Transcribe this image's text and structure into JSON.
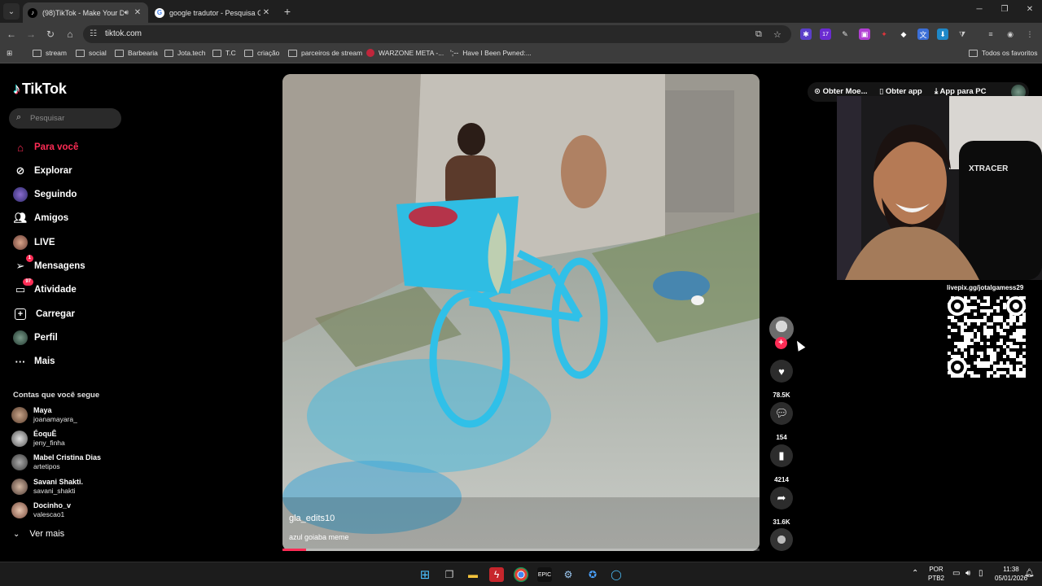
{
  "browser": {
    "tabs": [
      {
        "title": "(98)TikTok - Make Your Day",
        "active": true
      },
      {
        "title": "google tradutor - Pesquisa Goo",
        "active": false
      }
    ],
    "url": "tiktok.com",
    "bookmarks": [
      {
        "label": "stream",
        "type": "folder"
      },
      {
        "label": "social",
        "type": "folder"
      },
      {
        "label": "Barbearia",
        "type": "folder"
      },
      {
        "label": "Jota.tech",
        "type": "folder"
      },
      {
        "label": "T.C",
        "type": "folder"
      },
      {
        "label": "criação",
        "type": "folder"
      },
      {
        "label": "parceiros de stream",
        "type": "folder"
      },
      {
        "label": "WARZONE META -...",
        "type": "site"
      },
      {
        "label": "Have I Been Pwned:...",
        "type": "site"
      }
    ],
    "favorites_label": "Todos os favoritos",
    "extension_badge": "17"
  },
  "tiktok": {
    "logo": "TikTok",
    "search_placeholder": "Pesquisar",
    "nav": [
      {
        "label": "Para você",
        "icon": "home-icon",
        "active": true
      },
      {
        "label": "Explorar",
        "icon": "compass-icon"
      },
      {
        "label": "Seguindo",
        "icon": "following-avatar"
      },
      {
        "label": "Amigos",
        "icon": "friends-icon"
      },
      {
        "label": "LIVE",
        "icon": "live-avatar"
      },
      {
        "label": "Mensagens",
        "icon": "messages-icon",
        "badge": "1"
      },
      {
        "label": "Atividade",
        "icon": "activity-icon",
        "badge": "97"
      },
      {
        "label": "Carregar",
        "icon": "upload-icon"
      },
      {
        "label": "Perfil",
        "icon": "profile-avatar"
      },
      {
        "label": "Mais",
        "icon": "more-icon"
      }
    ],
    "following_title": "Contas que você segue",
    "accounts": [
      {
        "name": "Maya",
        "handle": "joanamayara_"
      },
      {
        "name": "ÉoquÊ",
        "handle": "jeny_finha"
      },
      {
        "name": "Mabel  Cristina  Dias",
        "handle": "artetipos"
      },
      {
        "name": "Savani Shakti.",
        "handle": "savani_shakti"
      },
      {
        "name": "Docinho_v",
        "handle": "valescao1"
      }
    ],
    "see_more": "Ver mais",
    "video": {
      "author": "gla_edits10",
      "description": "azul goiaba meme",
      "progress": 0.05
    },
    "actions": {
      "likes": "78.5K",
      "comments": "154",
      "saves": "4214",
      "shares": "31.6K"
    },
    "top_buttons": [
      "Obter Moe...",
      "Obter app",
      "App para PC"
    ]
  },
  "overlay": {
    "qr_url": "livepix.gg/jotalgamess29"
  },
  "taskbar": {
    "lang": "POR",
    "layout": "PTB2",
    "time": "11:38",
    "date": "05/01/2026"
  },
  "colors": {
    "accent": "#fe2c55",
    "chrome_dark": "#1f1f1f",
    "chrome_mid": "#3c3c3c"
  }
}
